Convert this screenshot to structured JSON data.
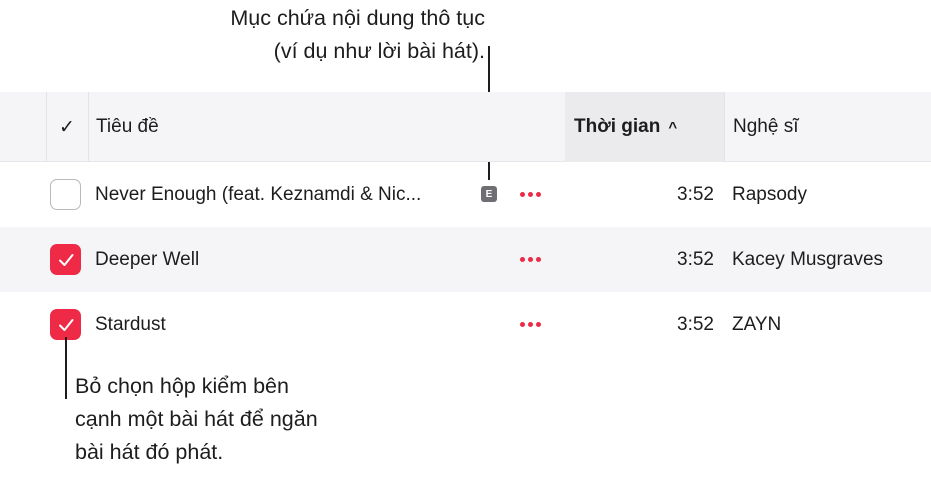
{
  "callouts": {
    "top_line1": "Mục chứa nội dung thô tục",
    "top_line2": "(ví dụ như lời bài hát).",
    "bottom_line1": "Bỏ chọn hộp kiểm bên",
    "bottom_line2": "cạnh một bài hát để ngăn",
    "bottom_line3": "bài hát đó phát."
  },
  "header": {
    "check_glyph": "✓",
    "title": "Tiêu đề",
    "time": "Thời gian",
    "time_sort_glyph": "^",
    "artist": "Nghệ sĩ"
  },
  "rows": [
    {
      "checked": false,
      "title": "Never Enough (feat. Keznamdi & Nic...",
      "explicit": "E",
      "more_icon": "ellipsis-icon",
      "time": "3:52",
      "artist": "Rapsody"
    },
    {
      "checked": true,
      "title": "Deeper Well",
      "more_icon": "ellipsis-icon",
      "time": "3:52",
      "artist": "Kacey Musgraves"
    },
    {
      "checked": true,
      "title": "Stardust",
      "more_icon": "ellipsis-icon",
      "time": "3:52",
      "artist": "ZAYN"
    }
  ],
  "colors": {
    "accent": "#ee2a46",
    "header_bg": "#f5f5f7",
    "sorted_col_bg": "#ebebed",
    "explicit_badge": "#6e6e73"
  }
}
